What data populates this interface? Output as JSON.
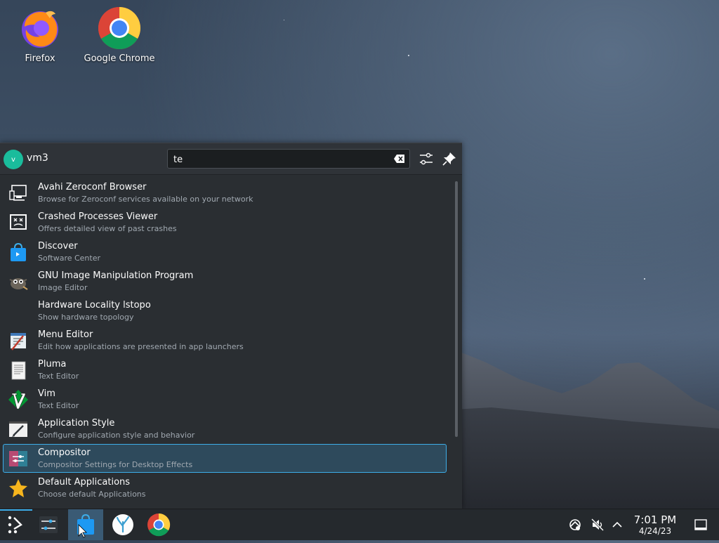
{
  "desktop": {
    "icons": [
      {
        "label": "Firefox",
        "icon": "firefox-icon"
      },
      {
        "label": "Google Chrome",
        "icon": "chrome-icon"
      }
    ]
  },
  "launcher": {
    "user": {
      "initial": "v",
      "name": "vm3"
    },
    "search": {
      "value": "te"
    },
    "results": [
      {
        "title": "Avahi Zeroconf Browser",
        "subtitle": "Browse for Zeroconf services available on your network",
        "icon": "monitor-network-icon"
      },
      {
        "title": "Crashed Processes Viewer",
        "subtitle": "Offers detailed view of past crashes",
        "icon": "crash-icon"
      },
      {
        "title": "Discover",
        "subtitle": "Software Center",
        "icon": "discover-bag-icon"
      },
      {
        "title": "GNU Image Manipulation Program",
        "subtitle": "Image Editor",
        "icon": "gimp-icon"
      },
      {
        "title": "Hardware Locality lstopo",
        "subtitle": "Show hardware topology",
        "icon": "blank-icon"
      },
      {
        "title": "Menu Editor",
        "subtitle": "Edit how applications are presented in app launchers",
        "icon": "menu-editor-icon"
      },
      {
        "title": "Pluma",
        "subtitle": "Text Editor",
        "icon": "text-document-icon"
      },
      {
        "title": "Vim",
        "subtitle": "Text Editor",
        "icon": "vim-icon"
      },
      {
        "title": "Application Style",
        "subtitle": "Configure application style and behavior",
        "icon": "brush-icon"
      },
      {
        "title": "Compositor",
        "subtitle": "Compositor Settings for Desktop Effects",
        "icon": "compositor-icon",
        "selected": true
      },
      {
        "title": "Default Applications",
        "subtitle": "Choose default Applications",
        "icon": "star-icon"
      }
    ]
  },
  "taskbar": {
    "clock": {
      "time": "7:01 PM",
      "date": "4/24/23"
    }
  },
  "colors": {
    "accent": "#3daee9",
    "selection": "#2e4a5c",
    "panel": "#2a2e32"
  }
}
